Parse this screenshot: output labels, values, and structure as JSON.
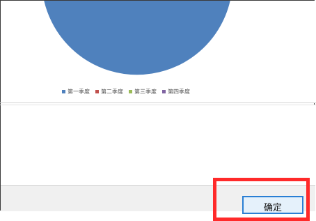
{
  "chart_data": {
    "type": "pie",
    "categories": [
      "第一季度",
      "第二季度",
      "第三季度",
      "第四季度"
    ],
    "values": [
      82,
      18,
      0,
      0
    ],
    "colors": [
      "#4f81bd",
      "#c0504d",
      "#9bbb59",
      "#8064a2"
    ],
    "legend_position": "bottom"
  },
  "legend": {
    "items": [
      {
        "label": "第一季度",
        "color": "#4f81bd"
      },
      {
        "label": "第二季度",
        "color": "#c0504d"
      },
      {
        "label": "第三季度",
        "color": "#9bbb59"
      },
      {
        "label": "第四季度",
        "color": "#8064a2"
      }
    ]
  },
  "dialog": {
    "ok_label": "确定"
  },
  "colors": {
    "highlight": "#ff2a2a",
    "button_border": "#2a7fd4"
  }
}
